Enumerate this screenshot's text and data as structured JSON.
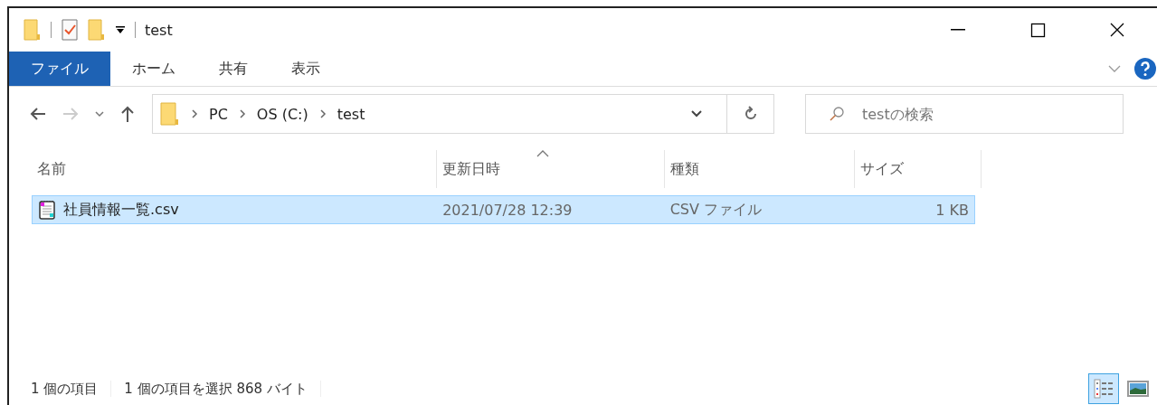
{
  "window": {
    "title": "test"
  },
  "ribbon_tabs": [
    {
      "label": "ファイル",
      "selected": true
    },
    {
      "label": "ホーム",
      "selected": false
    },
    {
      "label": "共有",
      "selected": false
    },
    {
      "label": "表示",
      "selected": false
    }
  ],
  "address": {
    "crumbs": [
      "PC",
      "OS (C:)",
      "test"
    ]
  },
  "search": {
    "placeholder": "testの検索"
  },
  "columns": [
    {
      "label": "名前",
      "sorted": false
    },
    {
      "label": "更新日時",
      "sorted": true
    },
    {
      "label": "種類",
      "sorted": false
    },
    {
      "label": "サイズ",
      "sorted": false
    }
  ],
  "rows": [
    {
      "name": "社員情報一覧.csv",
      "modified": "2021/07/28 12:39",
      "type": "CSV ファイル",
      "size": "1 KB",
      "selected": true
    }
  ],
  "status_bar": {
    "count": "1 個の項目",
    "selection": "1 個の項目を選択  868 バイト"
  },
  "views": [
    {
      "kind": "details",
      "selected": true
    },
    {
      "kind": "thumbnails",
      "selected": false
    }
  ]
}
